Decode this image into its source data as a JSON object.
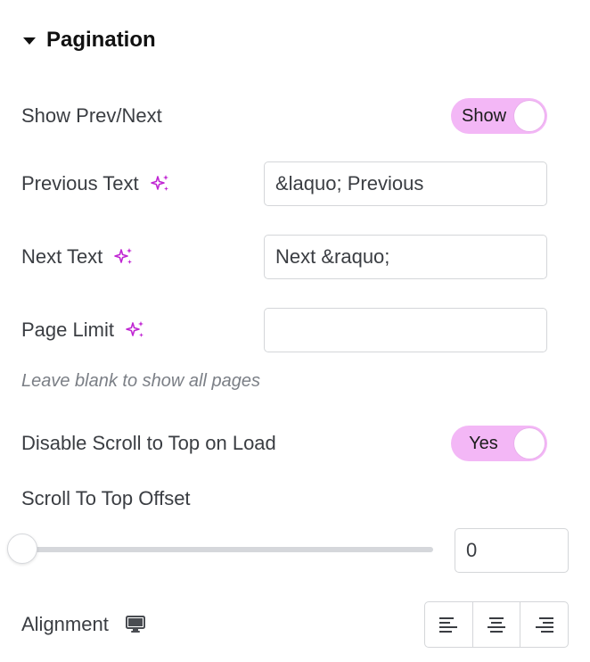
{
  "section": {
    "title": "Pagination"
  },
  "show_prev_next": {
    "label": "Show Prev/Next",
    "toggle_text": "Show"
  },
  "previous_text": {
    "label": "Previous Text",
    "value": "&laquo; Previous"
  },
  "next_text": {
    "label": "Next Text",
    "value": "Next &raquo;"
  },
  "page_limit": {
    "label": "Page Limit",
    "value": "",
    "help": "Leave blank to show all pages"
  },
  "disable_scroll": {
    "label": "Disable Scroll to Top on Load",
    "toggle_text": "Yes"
  },
  "scroll_offset": {
    "label": "Scroll To Top Offset",
    "value": "0",
    "slider_fraction": 0
  },
  "alignment": {
    "label": "Alignment",
    "options": [
      "left",
      "center",
      "right"
    ]
  },
  "icons": {
    "section_caret": "caret-down-icon",
    "ai_sparkle": "sparkle-icon",
    "responsive": "monitor-icon",
    "align_left": "align-left-icon",
    "align_center": "align-center-icon",
    "align_right": "align-right-icon"
  },
  "colors": {
    "toggle_on": "#f3b7f6",
    "sparkle": "#c026d3",
    "border": "#d4d6d9",
    "text": "#3a3d42",
    "help_text": "#7b7f86"
  }
}
